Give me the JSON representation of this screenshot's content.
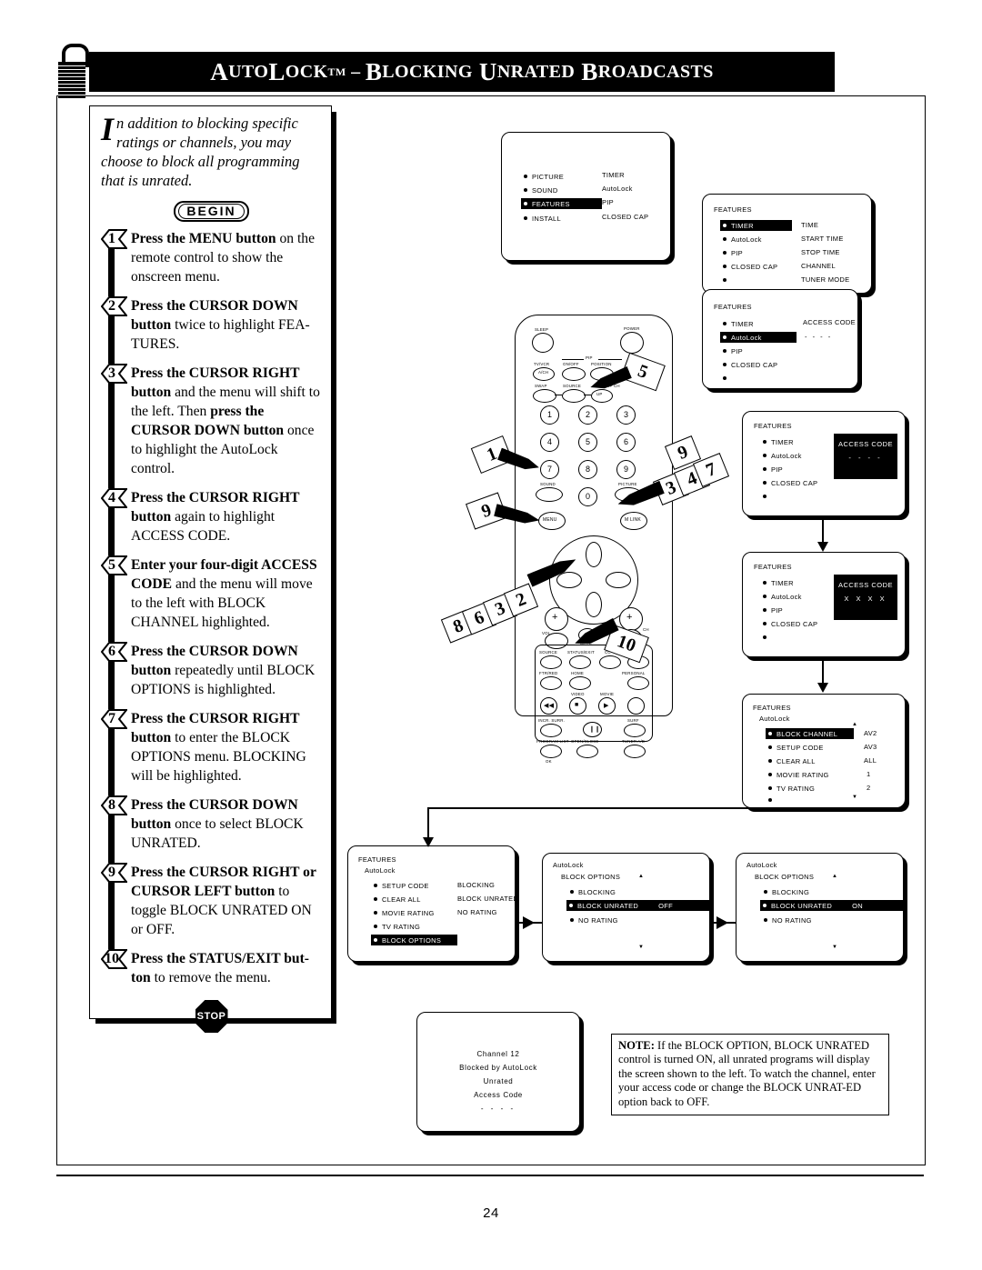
{
  "page": {
    "number": "24",
    "header_title_parts": [
      "A",
      "UTO",
      "L",
      "OCK",
      "TM",
      " – ",
      "B",
      "LOCKING",
      " U",
      "NRATED",
      " B",
      "ROADCASTS"
    ],
    "header_title": "AUTOLOCK™ – BLOCKING UNRATED BROADCASTS",
    "lock_icon": "padlock-icon"
  },
  "intro": {
    "dropcap": "I",
    "text": "n addition to blocking specific ratings or channels, you may choose to block all programming that is unrated."
  },
  "begin_label": "BEGIN",
  "stop_label": "STOP",
  "steps": [
    {
      "num": "1",
      "html": "<b>Press the MENU button</b> on the remote control to show the onscreen menu."
    },
    {
      "num": "2",
      "html": "<b>Press the CURSOR DOWN button</b> twice to highlight FEA-TURES."
    },
    {
      "num": "3",
      "html": "<b>Press the CURSOR RIGHT button</b> and the menu will shift to the left. Then <b>press the CURSOR DOWN button</b> once to highlight the AutoLock control."
    },
    {
      "num": "4",
      "html": "<b>Press the CURSOR RIGHT button</b> again to highlight ACCESS CODE."
    },
    {
      "num": "5",
      "html": "<b>Enter your four-digit ACCESS CODE</b> and the menu will move to the left with BLOCK CHANNEL highlighted."
    },
    {
      "num": "6",
      "html": "<b>Press the CURSOR DOWN button</b> repeatedly until BLOCK OPTIONS is highlighted."
    },
    {
      "num": "7",
      "html": "<b>Press the CURSOR RIGHT button</b> to enter the BLOCK OPTIONS menu. BLOCKING will be highlighted."
    },
    {
      "num": "8",
      "html": "<b>Press the CURSOR DOWN button</b> once to select BLOCK UNRATED."
    },
    {
      "num": "9",
      "html": "<b>Press the CURSOR RIGHT or CURSOR LEFT button</b> to toggle BLOCK UNRATED ON or OFF."
    },
    {
      "num": "10",
      "html": "<b>Press the STATUS/EXIT but-ton</b> to remove the menu."
    }
  ],
  "screens": {
    "main_menu": {
      "left_items": [
        "PICTURE",
        "SOUND",
        "FEATURES",
        "INSTALL"
      ],
      "highlighted": "FEATURES",
      "right_items": [
        "TIMER",
        "AutoLock",
        "PIP",
        "CLOSED CAP"
      ]
    },
    "features_timer": {
      "header": "FEATURES",
      "left_items": [
        "TIMER",
        "AutoLock",
        "PIP",
        "CLOSED CAP",
        ""
      ],
      "highlighted": "TIMER",
      "right_items": [
        "TIME",
        "START TIME",
        "STOP TIME",
        "CHANNEL",
        "TUNER MODE"
      ]
    },
    "features_autolock": {
      "header": "FEATURES",
      "left_items": [
        "TIMER",
        "AutoLock",
        "PIP",
        "CLOSED CAP",
        ""
      ],
      "highlighted": "AutoLock",
      "right_label": "ACCESS CODE",
      "right_value": "- - - -"
    },
    "access_code_empty": {
      "header": "FEATURES",
      "left_items": [
        "TIMER",
        "AutoLock",
        "PIP",
        "CLOSED CAP",
        ""
      ],
      "highlighted": "AutoLock",
      "code_title": "ACCESS CODE",
      "code_value": "- - - -"
    },
    "access_code_entered": {
      "header": "FEATURES",
      "left_items": [
        "TIMER",
        "AutoLock",
        "PIP",
        "CLOSED CAP",
        ""
      ],
      "highlighted": "AutoLock",
      "code_title": "ACCESS CODE",
      "code_value": "X X X X"
    },
    "autolock_block_channel": {
      "header": "FEATURES",
      "sub": "AutoLock",
      "left_items": [
        "BLOCK CHANNEL",
        "SETUP CODE",
        "CLEAR ALL",
        "MOVIE RATING",
        "TV RATING",
        ""
      ],
      "highlighted": "BLOCK CHANNEL",
      "right_items": [
        "AV2",
        "AV3",
        "ALL",
        "1",
        "2"
      ]
    },
    "autolock_block_options": {
      "header": "FEATURES",
      "sub": "AutoLock",
      "left_items": [
        "SETUP CODE",
        "CLEAR ALL",
        "MOVIE RATING",
        "TV RATING",
        "BLOCK OPTIONS"
      ],
      "highlighted": "BLOCK OPTIONS",
      "right_items": [
        "BLOCKING",
        "BLOCK UNRATED",
        "NO RATING"
      ]
    },
    "block_unrated_off": {
      "header": "AutoLock",
      "sub": "BLOCK OPTIONS",
      "left_items": [
        "BLOCKING",
        "BLOCK UNRATED",
        "NO RATING"
      ],
      "highlighted": "BLOCK UNRATED",
      "value": "OFF"
    },
    "block_unrated_on": {
      "header": "AutoLock",
      "sub": "BLOCK OPTIONS",
      "left_items": [
        "BLOCKING",
        "BLOCK UNRATED",
        "NO RATING"
      ],
      "highlighted": "BLOCK UNRATED",
      "value": "ON"
    },
    "blocked_screen": {
      "lines": [
        "Channel  12",
        "Blocked  by  AutoLock",
        "Unrated",
        "Access  Code",
        "- - - -"
      ]
    }
  },
  "note": {
    "label": "NOTE:",
    "text": " If the BLOCK OPTION, BLOCK UNRATED control is turned ON, all unrated programs will display the screen shown to the left. To watch the channel, enter your access code or change the BLOCK UNRAT-ED option back to OFF."
  },
  "remote": {
    "labels": [
      "SLEEP",
      "POWER",
      "PIP",
      "TV/VCR",
      "ON/OFF",
      "POSITION",
      "FREEZE",
      "A/CH",
      "SWAP",
      "SOURCE",
      "PIP CH",
      "UP",
      "SOUND",
      "PICTURE",
      "MENU",
      "M LINK",
      "VOL",
      "CH",
      "MUTE",
      "SOURCE",
      "STATUS/EXIT",
      "CC",
      "CLOCK",
      "FTR/RED",
      "HOME",
      "PERSONAL",
      "VIDEO",
      "MOVIE",
      "INCR. SURR.",
      "SURF",
      "PROGRAM LIST",
      "OPEN/CLOSE",
      "TUNER A/B",
      "OK"
    ],
    "numbers": [
      "1",
      "2",
      "3",
      "4",
      "5",
      "6",
      "7",
      "8",
      "9",
      "0"
    ],
    "callouts": [
      "1",
      "2",
      "3",
      "4",
      "5",
      "6",
      "7",
      "8",
      "9",
      "10"
    ]
  }
}
